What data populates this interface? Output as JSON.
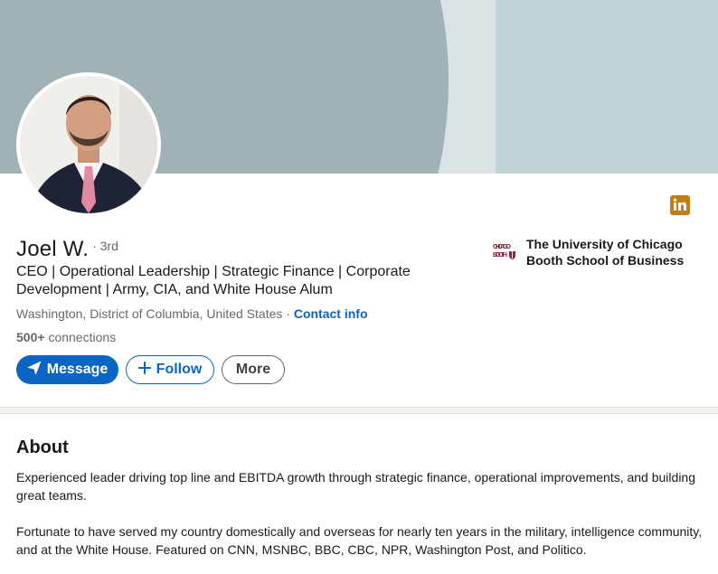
{
  "profile": {
    "name": "Joel W.",
    "degree": "· 3rd",
    "headline": "CEO | Operational Leadership | Strategic Finance | Corporate Development | Army, CIA, and White House Alum",
    "location": "Washington, District of Columbia, United States",
    "separator": "·",
    "contact_link": "Contact info",
    "connections_count": "500+",
    "connections_label": "connections"
  },
  "actions": {
    "message_label": "Message",
    "follow_label": "Follow",
    "more_label": "More"
  },
  "education": {
    "logo_text_top": "CHICAGO",
    "logo_text_bottom": "BOOTH",
    "school_name": "The University of Chicago Booth School of Business"
  },
  "about": {
    "title": "About",
    "paragraph_1": "Experienced leader driving top line and EBITDA growth through strategic finance, operational improvements, and building great teams.",
    "paragraph_2": "Fortunate to have served my country domestically and overseas for nearly ten years in the military, intelligence community, and at the White House. Featured on CNN, MSNBC, BBC, CBC, NPR, Washington Post, and Politico."
  },
  "icons": {
    "linkedin_badge": "linkedin-icon",
    "message": "paper-plane-icon",
    "follow": "plus-icon"
  },
  "colors": {
    "brand_blue": "#0a66c2",
    "linkedin_badge": "#c37d16",
    "banner_light": "#bfd3d6",
    "banner_dark": "#a0b2b5",
    "booth_red": "#a6192e"
  }
}
